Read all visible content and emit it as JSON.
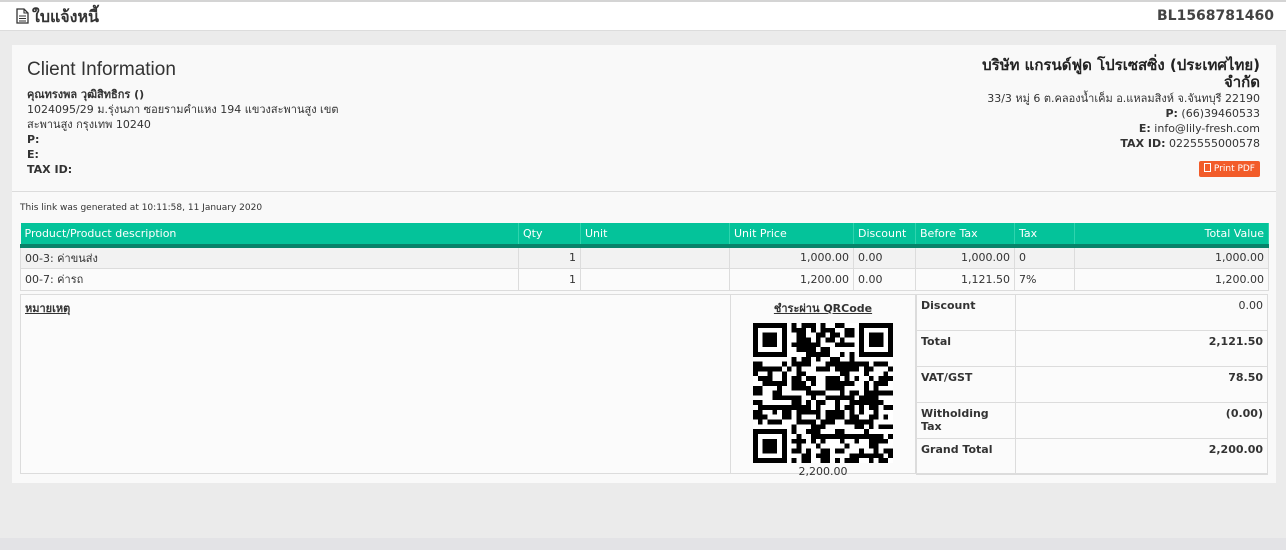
{
  "header": {
    "title": "ใบแจ้งหนี้",
    "doc_number": "BL1568781460"
  },
  "client": {
    "heading": "Client Information",
    "name": "คุณทรงพล วุฒิสิทธิกร ()",
    "address_line1": "1024095/29 ม.รุ่งนภา ซอยรามคำแหง 194 แขวงสะพานสูง เขต",
    "address_line2": "สะพานสูง กรุงเทพ 10240",
    "phone_label": "P:",
    "phone": "",
    "email_label": "E:",
    "email": "",
    "tax_label": "TAX ID:",
    "tax_id": ""
  },
  "company": {
    "name_line1": "บริษัท แกรนด์ฟูด โปรเซสซิ่ง (ประเทศไทย)",
    "name_line2": "จำกัด",
    "address": "33/3 หมู่ 6 ต.คลองน้ำเค็ม อ.แหลมสิงห์ จ.จันทบุรี 22190",
    "phone_label": "P:",
    "phone": "(66)39460533",
    "email_label": "E:",
    "email": "info@lily-fresh.com",
    "tax_label": "TAX ID:",
    "tax_id": "0225555000578"
  },
  "actions": {
    "print_pdf": "Print PDF"
  },
  "generated_note": "This link was generated at 10:11:58, 11 January 2020",
  "table": {
    "columns": [
      "Product/Product description",
      "Qty",
      "Unit",
      "Unit Price",
      "Discount",
      "Before Tax",
      "Tax",
      "Total Value"
    ],
    "rows": [
      {
        "product": "00-3: ค่าขนส่ง",
        "qty": "1",
        "unit": "",
        "unit_price": "1,000.00",
        "discount": "0.00",
        "before_tax": "1,000.00",
        "tax": "0",
        "total": "1,000.00"
      },
      {
        "product": "00-7: ค่ารถ",
        "qty": "1",
        "unit": "",
        "unit_price": "1,200.00",
        "discount": "0.00",
        "before_tax": "1,121.50",
        "tax": "7%",
        "total": "1,200.00"
      }
    ]
  },
  "notes": {
    "label": "หมายเหตุ"
  },
  "qr": {
    "title": "ชำระผ่าน QRCode",
    "amount": "2,200.00"
  },
  "totals": [
    {
      "label": "Discount",
      "value": "0.00"
    },
    {
      "label": "Total",
      "value": "2,121.50"
    },
    {
      "label": "VAT/GST",
      "value": "78.50"
    },
    {
      "label": "Witholding Tax",
      "value": "(0.00)"
    },
    {
      "label": "Grand Total",
      "value": "2,200.00"
    }
  ],
  "colors": {
    "table_header": "#04c39a",
    "print_button": "#f25c2a"
  },
  "icons": {
    "title_icon": "document-icon",
    "print_icon": "pdf-icon"
  }
}
